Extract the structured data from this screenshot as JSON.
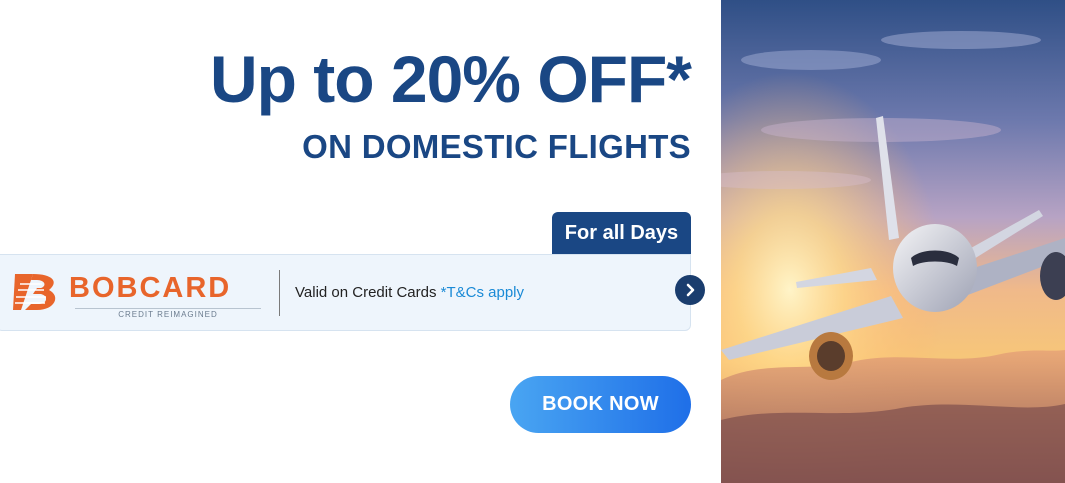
{
  "banner": {
    "headline": "Up to 20% OFF*",
    "subheadline": "ON DOMESTIC FLIGHTS",
    "days_tag": "For all Days"
  },
  "offer": {
    "brand_name": "BOBCARD",
    "brand_tagline": "CREDIT REIMAGINED",
    "valid_text": "Valid on Credit Cards ",
    "tnc_label": "*T&Cs apply",
    "next_icon": "chevron-right-icon"
  },
  "cta": {
    "book_label": "BOOK NOW"
  },
  "hero": {
    "image": "airplane-in-sunset-sky"
  },
  "colors": {
    "primary_navy": "#1a4784",
    "brand_orange": "#e8652b",
    "cta_gradient_start": "#49a5f2",
    "cta_gradient_end": "#1f6fe8",
    "link_blue": "#1a8ad6"
  }
}
